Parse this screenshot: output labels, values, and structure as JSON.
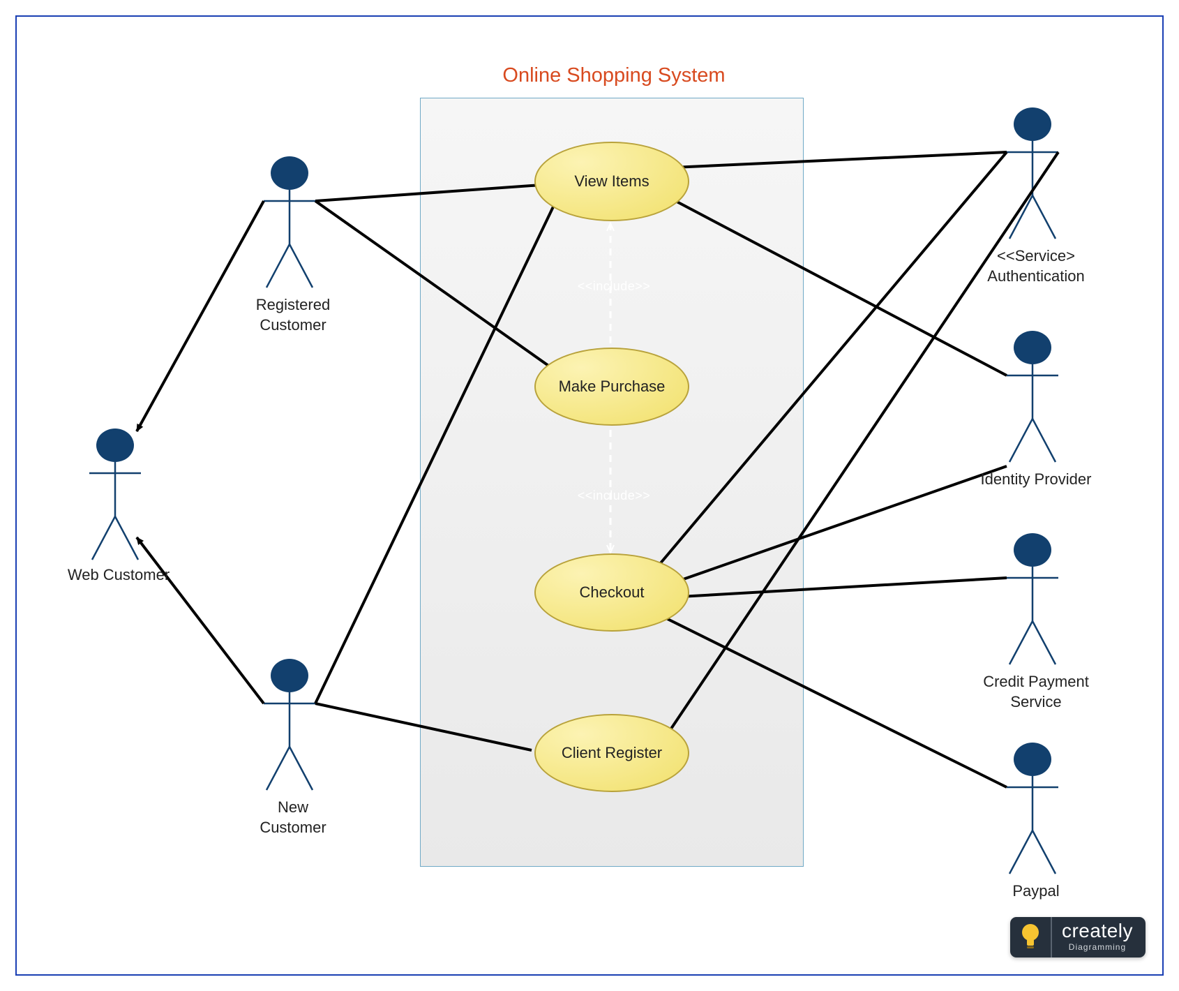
{
  "diagram": {
    "title": "Online Shopping System",
    "systemBoundary": "Online Shopping System",
    "actors": {
      "webCustomer": "Web Customer",
      "registeredCustomer": "Registered\nCustomer",
      "newCustomer": "New\nCustomer",
      "authentication": "<<Service>\nAuthentication",
      "identityProvider": "Identity Provider",
      "creditPayment": "Credit Payment\nService",
      "paypal": "Paypal"
    },
    "useCases": {
      "viewItems": "View Items",
      "makePurchase": "Make Purchase",
      "checkout": "Checkout",
      "clientRegister": "Client Register"
    },
    "includeLabels": {
      "a": "<<include>>",
      "b": "<<include>>"
    },
    "generalizations": [
      {
        "child": "registeredCustomer",
        "parent": "webCustomer"
      },
      {
        "child": "newCustomer",
        "parent": "webCustomer"
      }
    ],
    "associations": [
      [
        "registeredCustomer",
        "viewItems"
      ],
      [
        "registeredCustomer",
        "makePurchase"
      ],
      [
        "newCustomer",
        "viewItems"
      ],
      [
        "newCustomer",
        "clientRegister"
      ],
      [
        "viewItems",
        "authentication"
      ],
      [
        "viewItems",
        "identityProvider"
      ],
      [
        "checkout",
        "authentication"
      ],
      [
        "checkout",
        "identityProvider"
      ],
      [
        "checkout",
        "creditPayment"
      ],
      [
        "checkout",
        "paypal"
      ],
      [
        "clientRegister",
        "authentication"
      ]
    ],
    "includes": [
      {
        "from": "makePurchase",
        "to": "viewItems"
      },
      {
        "from": "makePurchase",
        "to": "checkout"
      }
    ]
  },
  "branding": {
    "name": "creately",
    "tagline": "Diagramming"
  },
  "colors": {
    "frame": "#1a3fb3",
    "title": "#d84a1f",
    "actorHead": "#12406e",
    "usecaseFill": "#f1e06a"
  }
}
